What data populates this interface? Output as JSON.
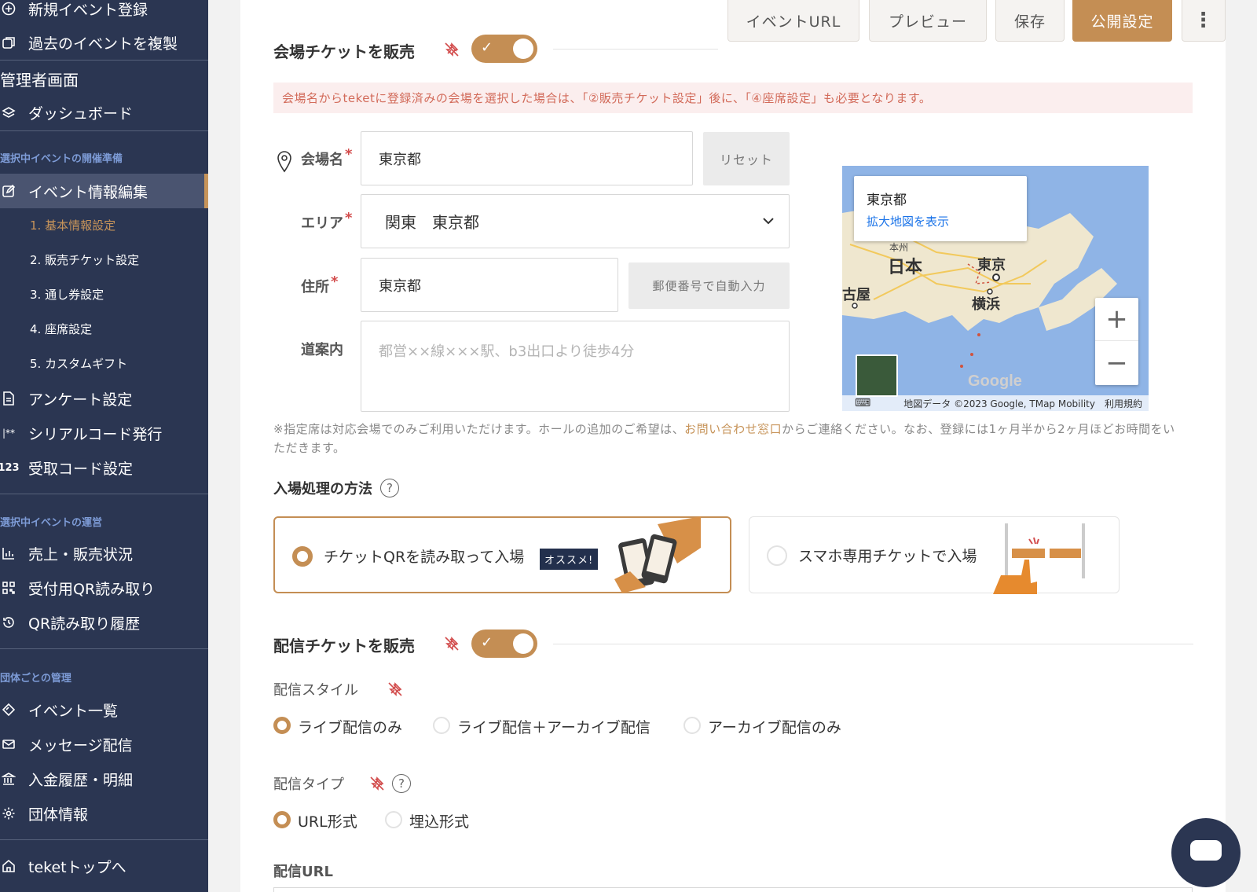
{
  "sidebar": {
    "top_items": [
      "新規イベント登録",
      "過去のイベントを複製"
    ],
    "admin_label": "管理者画面",
    "dashboard": "ダッシュボード",
    "section_prep": "選択中イベントの開催準備",
    "event_edit": "イベント情報編集",
    "sub_items": [
      "1. 基本情報設定",
      "2. 販売チケット設定",
      "3. 通し券設定",
      "4. 座席設定",
      "5. カスタムギフト"
    ],
    "prep_items": [
      "アンケート設定",
      "シリアルコード発行",
      "受取コード設定"
    ],
    "serial_icon_text": "|**",
    "code_icon_text": "123",
    "section_ops": "選択中イベントの運営",
    "ops_items": [
      "売上・販売状況",
      "受付用QR読み取り",
      "QR読み取り履歴"
    ],
    "section_org": "団体ごとの管理",
    "org_items": [
      "イベント一覧",
      "メッセージ配信",
      "入金履歴・明細",
      "団体情報"
    ],
    "teket_top": "teketトップへ"
  },
  "toolbar": {
    "event_url": "イベントURL",
    "preview": "プレビュー",
    "save": "保存",
    "publish": "公開設定",
    "more": "⋮"
  },
  "venue_section": {
    "title": "会場チケットを販売",
    "alert": "会場名からteketに登録済みの会場を選択した場合は、「②販売チケット設定」後に、「④座席設定」も必要となります。",
    "venue_label": "会場名",
    "venue_value": "東京都",
    "reset": "リセット",
    "area_label": "エリア",
    "area_value": "関東　東京都",
    "address_label": "住所",
    "address_value": "東京都",
    "zip_button": "郵便番号で自動入力",
    "directions_label": "道案内",
    "directions_placeholder": "都営××線×××駅、b3出口より徒歩4分",
    "note_prefix": "※指定席は対応会場でのみご利用いただけます。ホールの追加のご希望は、",
    "note_link": "お問い合わせ窓口",
    "note_suffix": "からご連絡ください。なお、登録には1ヶ月半から2ヶ月ほどお時間をいただきます。",
    "entry_title": "入場処理の方法",
    "entry_options": [
      {
        "label": "チケットQRを読み取って入場",
        "badge": "オススメ!",
        "selected": true
      },
      {
        "label": "スマホ専用チケットで入場",
        "selected": false
      }
    ]
  },
  "map": {
    "popup_title": "東京都",
    "popup_link": "拡大地図を表示",
    "labels": [
      "本州",
      "日本",
      "東京",
      "古屋",
      "横浜"
    ],
    "google": "Google",
    "attribution": "地図データ ©2023 Google, TMap Mobility",
    "terms": "利用規約",
    "zoom_in": "+",
    "zoom_out": "−"
  },
  "stream_section": {
    "title": "配信チケットを販売",
    "style_title": "配信スタイル",
    "style_options": [
      {
        "label": "ライブ配信のみ",
        "selected": true
      },
      {
        "label": "ライブ配信＋アーカイブ配信",
        "selected": false
      },
      {
        "label": "アーカイブ配信のみ",
        "selected": false
      }
    ],
    "type_title": "配信タイプ",
    "type_options": [
      {
        "label": "URL形式",
        "selected": true
      },
      {
        "label": "埋込形式",
        "selected": false
      }
    ],
    "url_title": "配信URL"
  },
  "colors": {
    "sidebar_bg": "#2b3652",
    "accent": "#c48e54",
    "alert_bg": "#fbeeee",
    "alert_text": "#d26a59"
  }
}
